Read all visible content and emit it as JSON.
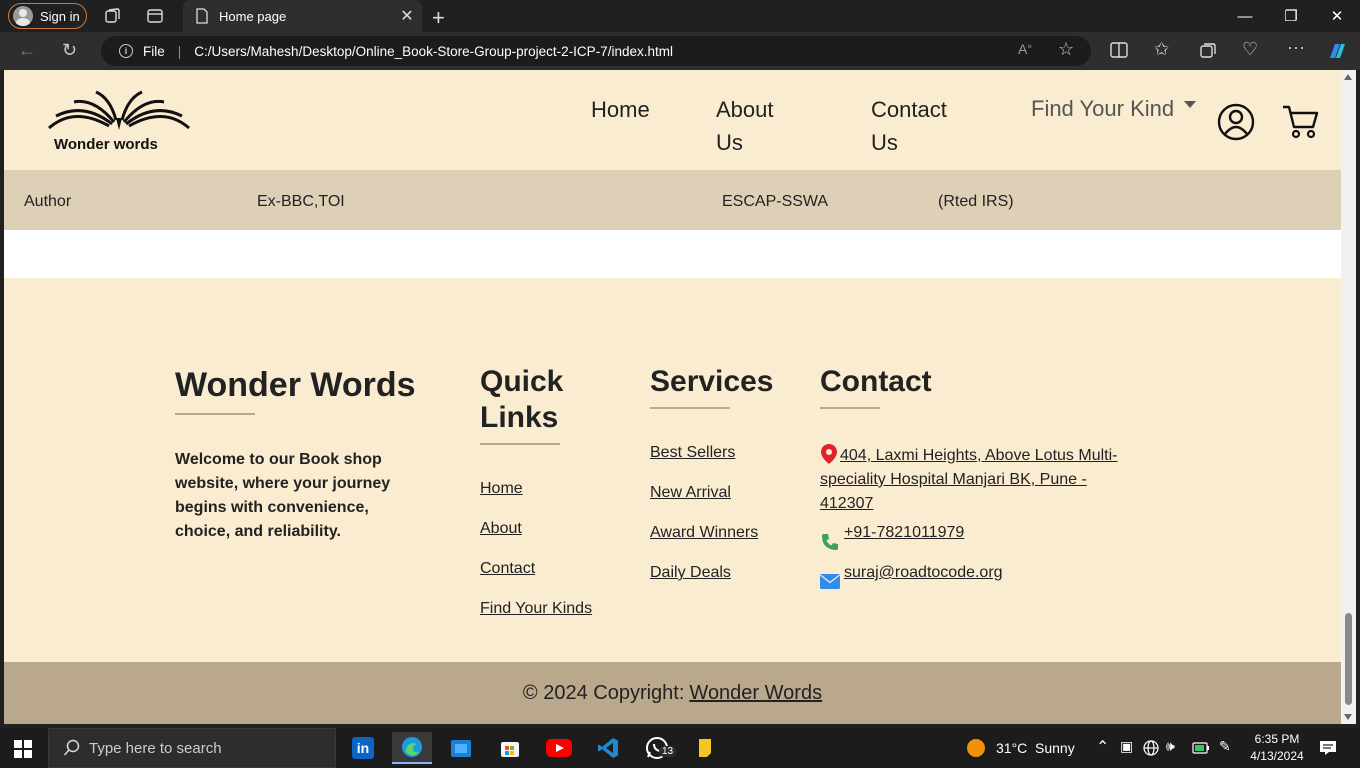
{
  "browser": {
    "signin_label": "Sign in",
    "tab_title": "Home page",
    "url_scheme_label": "File",
    "url": "C:/Users/Mahesh/Desktop/Online_Book-Store-Group-project-2-ICP-7/index.html"
  },
  "site": {
    "logo_text": "Wonder words",
    "nav": {
      "home": "Home",
      "about_line1": "About",
      "about_line2": "Us",
      "contact_line1": "Contact",
      "contact_line2": "Us",
      "find": "Find Your Kind"
    },
    "author_row": {
      "col1": "Author",
      "col2": "Ex-BBC,TOI",
      "col3": "ESCAP-SSWA",
      "col4": "(Rted IRS)"
    },
    "footer": {
      "brand_title": "Wonder Words",
      "brand_text": "Welcome to our Book shop website, where your journey begins with convenience, choice, and reliability.",
      "quick_title_1": "Quick",
      "quick_title_2": "Links",
      "quick_links": [
        "Home",
        "About",
        "Contact",
        "Find Your Kinds"
      ],
      "services_title": "Services",
      "services": [
        "Best Sellers",
        "New Arrival",
        "Award Winners",
        "Daily Deals"
      ],
      "contact_title": "Contact",
      "address_line1": " 404, Laxmi Heights, Above Lotus Multi-",
      "address_line2": "speciality Hospital Manjari BK, Pune -",
      "address_line3": "412307",
      "phone": " +91-7821011979",
      "email": " suraj@roadtocode.org",
      "copyright": "© 2024 Copyright:",
      "copyright_link": "Wonder Words"
    }
  },
  "taskbar": {
    "search_placeholder": "Type here to search",
    "whatsapp_badge": "13",
    "weather_temp": "31°C",
    "weather_desc": "Sunny",
    "time": "6:35 PM",
    "date": "4/13/2024"
  },
  "colors": {
    "header_bg": "#faecd0",
    "author_bg": "#ded0b6",
    "footer_bottom_bg": "#b9a88b"
  }
}
